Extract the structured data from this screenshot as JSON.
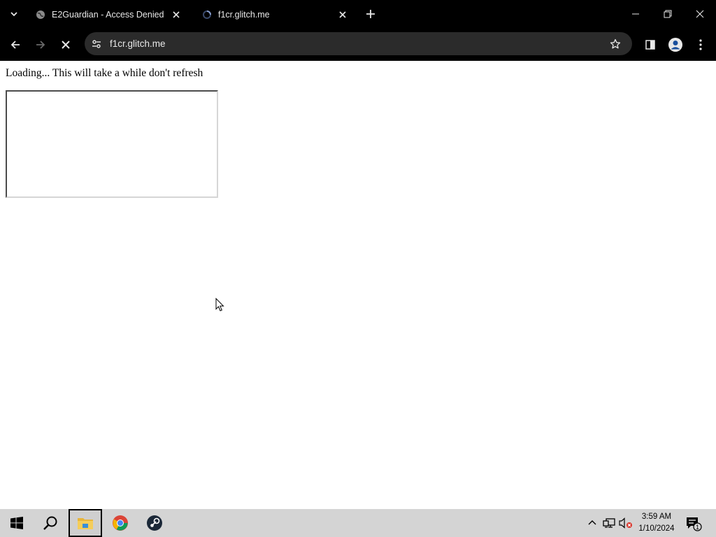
{
  "browser": {
    "tabs": [
      {
        "title": "E2Guardian - Access Denied",
        "favicon": "globe-icon",
        "active": false
      },
      {
        "title": "f1cr.glitch.me",
        "favicon": "loading-spinner-icon",
        "active": true
      }
    ],
    "address_bar": {
      "url": "f1cr.glitch.me"
    }
  },
  "page": {
    "loading_text": "Loading... This will take a while don't refresh"
  },
  "taskbar": {
    "pinned": [
      "windows-start-icon",
      "search-icon",
      "file-explorer-icon",
      "chrome-icon",
      "steam-icon"
    ],
    "clock": {
      "time": "3:59 AM",
      "date": "1/10/2024"
    },
    "notification_count": "1"
  },
  "colors": {
    "browser_chrome": "#000000",
    "omnibox_bg": "#2b2b2b",
    "page_bg": "#ffffff",
    "taskbar_bg": "#d4d4d4"
  }
}
